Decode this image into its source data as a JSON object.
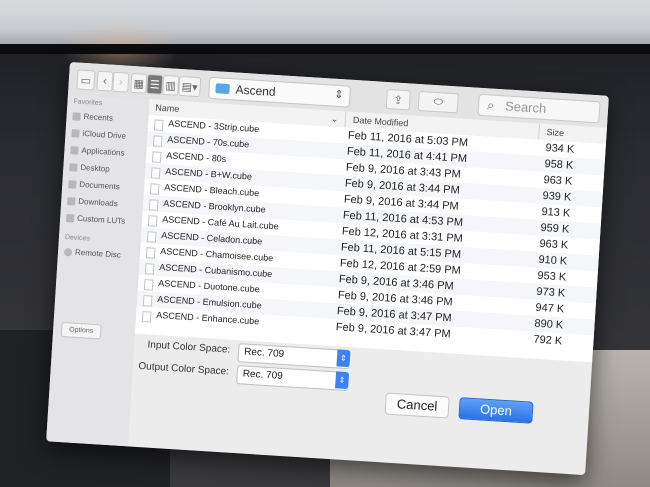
{
  "toolbar": {
    "view_buttons": [
      "sidebar",
      "back",
      "forward",
      "icon-view",
      "list-view",
      "column-view",
      "gallery-view"
    ],
    "folder": "Ascend",
    "search_placeholder": "Search"
  },
  "sidebar": {
    "favorites_header": "Favorites",
    "favorites": [
      {
        "label": "Recents",
        "icon": "clock-icon"
      },
      {
        "label": "iCloud Drive",
        "icon": "cloud-icon"
      },
      {
        "label": "Applications",
        "icon": "applications-icon"
      },
      {
        "label": "Desktop",
        "icon": "desktop-icon"
      },
      {
        "label": "Documents",
        "icon": "documents-icon"
      },
      {
        "label": "Downloads",
        "icon": "downloads-icon"
      },
      {
        "label": "Custom LUTs",
        "icon": "folder-icon"
      }
    ],
    "devices_header": "Devices",
    "devices": [
      {
        "label": "Remote Disc",
        "icon": "disc-icon"
      }
    ]
  },
  "columns": {
    "name": "Name",
    "date": "Date Modified",
    "size": "Size",
    "sort_indicator": "⌄"
  },
  "files": [
    {
      "name": "ASCEND - 3Strip.cube",
      "date": "Feb 11, 2016 at 5:03 PM",
      "size": "934 K"
    },
    {
      "name": "ASCEND - 70s.cube",
      "date": "Feb 11, 2016 at 4:41 PM",
      "size": "958 K"
    },
    {
      "name": "ASCEND - 80s",
      "date": "Feb 9, 2016 at 3:43 PM",
      "size": "963 K"
    },
    {
      "name": "ASCEND - B+W.cube",
      "date": "Feb 9, 2016 at 3:44 PM",
      "size": "939 K"
    },
    {
      "name": "ASCEND - Bleach.cube",
      "date": "Feb 9, 2016 at 3:44 PM",
      "size": "913 K"
    },
    {
      "name": "ASCEND - Brooklyn.cube",
      "date": "Feb 11, 2016 at 4:53 PM",
      "size": "959 K"
    },
    {
      "name": "ASCEND - Café Au Lait.cube",
      "date": "Feb 12, 2016 at 3:31 PM",
      "size": "963 K"
    },
    {
      "name": "ASCEND - Celadon.cube",
      "date": "Feb 11, 2016 at 5:15 PM",
      "size": "910 K"
    },
    {
      "name": "ASCEND - Chamoisee.cube",
      "date": "Feb 12, 2016 at 2:59 PM",
      "size": "953 K"
    },
    {
      "name": "ASCEND - Cubanismo.cube",
      "date": "Feb 9, 2016 at 3:46 PM",
      "size": "973 K"
    },
    {
      "name": "ASCEND - Duotone.cube",
      "date": "Feb 9, 2016 at 3:46 PM",
      "size": "947 K"
    },
    {
      "name": "ASCEND - Emulsion.cube",
      "date": "Feb 9, 2016 at 3:47 PM",
      "size": "890 K"
    },
    {
      "name": "ASCEND - Enhance.cube",
      "date": "Feb 9, 2016 at 3:47 PM",
      "size": "792 K"
    }
  ],
  "options": {
    "input_label": "Input Color Space:",
    "input_value": "Rec. 709",
    "output_label": "Output Color Space:",
    "output_value": "Rec. 709"
  },
  "footer": {
    "options_label": "Options",
    "cancel_label": "Cancel",
    "open_label": "Open"
  },
  "colors": {
    "accent": "#3b82f6",
    "folder": "#5aa7e6"
  }
}
